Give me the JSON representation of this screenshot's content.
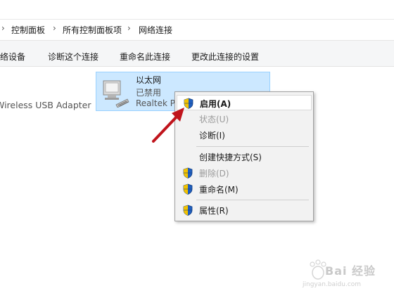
{
  "breadcrumb": {
    "items": [
      "控制面板",
      "所有控制面板项",
      "网络连接"
    ],
    "separator": "›"
  },
  "toolbar": {
    "items": [
      "络设备",
      "诊断这个连接",
      "重命名此连接",
      "更改此连接的设置"
    ]
  },
  "adapters": {
    "left_partial_label": "Wireless USB Adapter",
    "selected": {
      "name": "以太网",
      "status": "已禁用",
      "device": "Realtek P"
    }
  },
  "context_menu": {
    "items": [
      {
        "label": "启用(A)",
        "shield": true,
        "disabled": false,
        "bold": true,
        "highlighted": true
      },
      {
        "label": "状态(U)",
        "shield": false,
        "disabled": true,
        "bold": false,
        "highlighted": false
      },
      {
        "label": "诊断(I)",
        "shield": false,
        "disabled": false,
        "bold": false,
        "highlighted": false
      },
      {
        "label": "创建快捷方式(S)",
        "shield": false,
        "disabled": false,
        "bold": false,
        "highlighted": false
      },
      {
        "label": "删除(D)",
        "shield": true,
        "disabled": true,
        "bold": false,
        "highlighted": false
      },
      {
        "label": "重命名(M)",
        "shield": true,
        "disabled": false,
        "bold": false,
        "highlighted": false
      },
      {
        "label": "属性(R)",
        "shield": true,
        "disabled": false,
        "bold": false,
        "highlighted": false
      }
    ]
  },
  "watermark": {
    "brand": "Bai 经验",
    "url": "jingyan.baidu.com"
  },
  "colors": {
    "selection_bg": "#cce8ff",
    "selection_border": "#99d1ff",
    "menu_bg": "#f2f2f2",
    "arrow": "#c0141c",
    "disabled_text": "#9a9a9a"
  }
}
